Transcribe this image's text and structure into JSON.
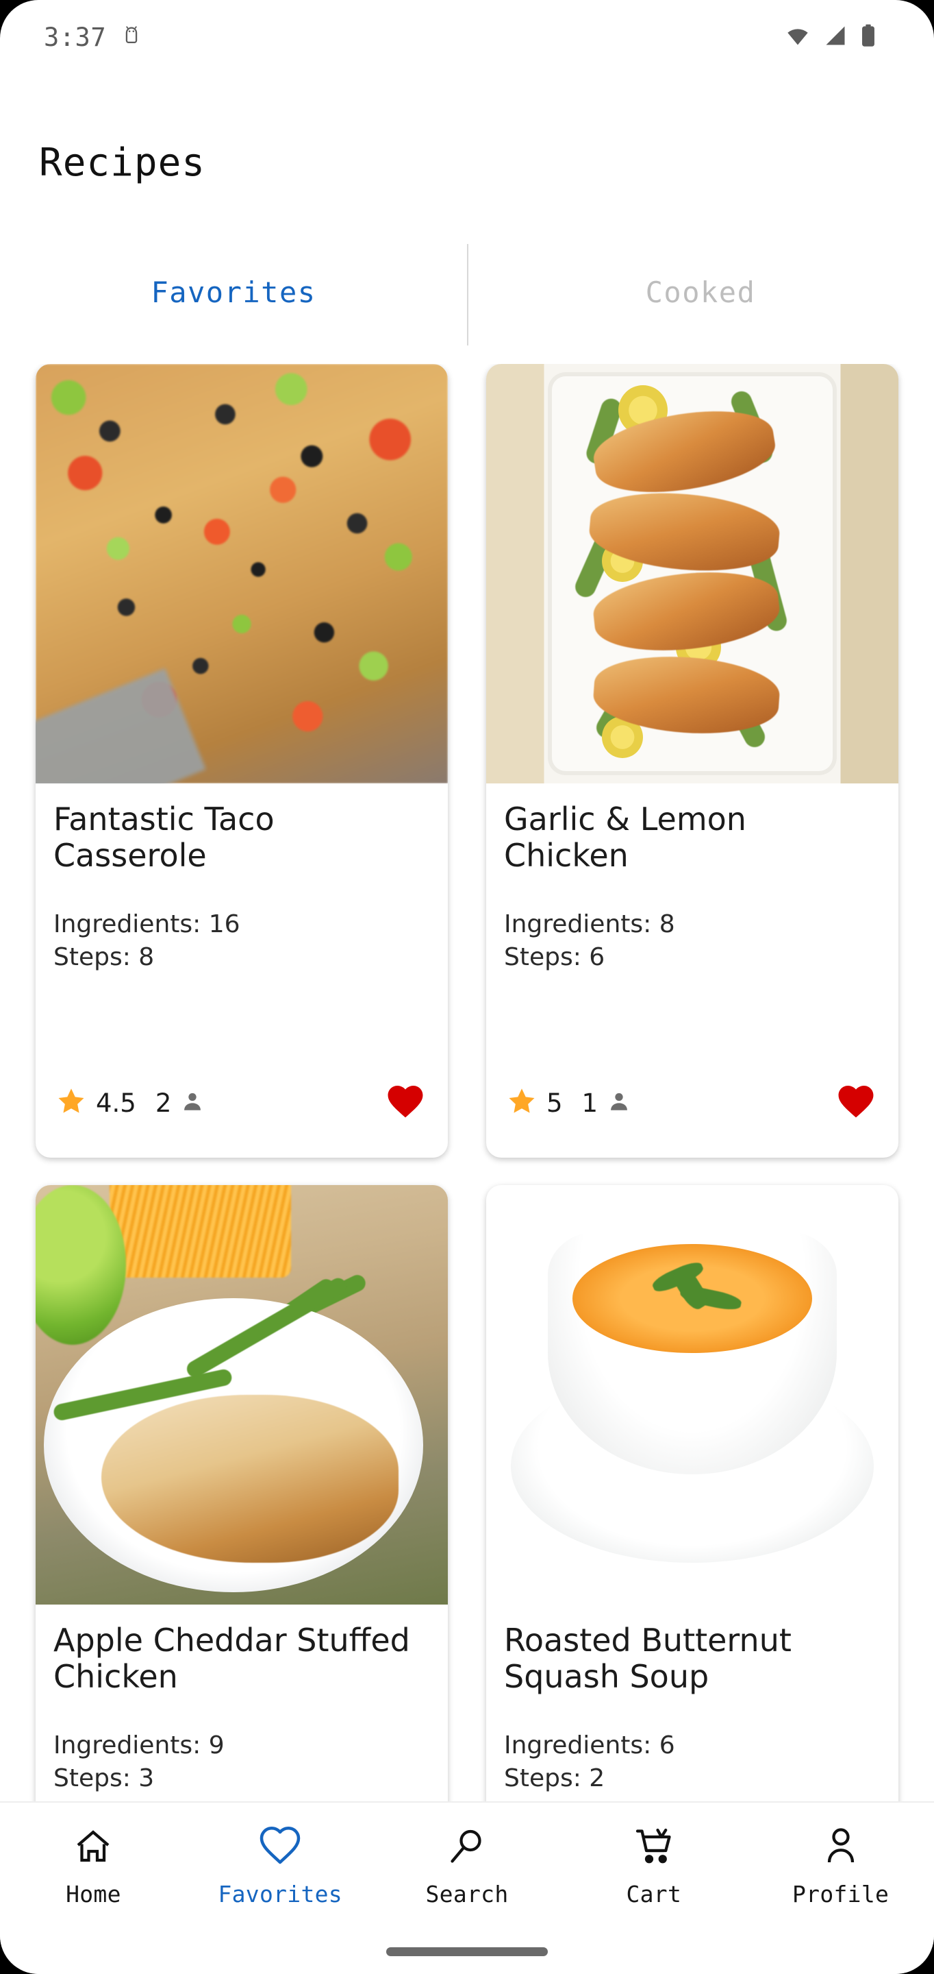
{
  "status_bar": {
    "time": "3:37",
    "icons": [
      "android-icon",
      "wifi-icon",
      "cellular-signal-icon",
      "battery-icon"
    ]
  },
  "header": {
    "title": "Recipes"
  },
  "tabs": [
    {
      "label": "Favorites",
      "active": true
    },
    {
      "label": "Cooked",
      "active": false
    }
  ],
  "colors": {
    "accent_blue": "#1565C0",
    "star_orange": "#FFA726",
    "heart_red": "#D50000",
    "inactive_gray": "#BDBDBD",
    "card_bg": "#FFFFFF",
    "page_bg": "#FFFFFF"
  },
  "recipes": [
    {
      "title": "Fantastic Taco Casserole",
      "ingredients_label": "Ingredients: 16",
      "steps_label": "Steps: 8",
      "ingredients": 16,
      "steps": 8,
      "rating": "4.5",
      "people": "2",
      "favorited": true,
      "image_alt": "taco-casserole-photo"
    },
    {
      "title": "Garlic & Lemon Chicken",
      "ingredients_label": "Ingredients: 8",
      "steps_label": "Steps: 6",
      "ingredients": 8,
      "steps": 6,
      "rating": "5",
      "people": "1",
      "favorited": true,
      "image_alt": "garlic-lemon-chicken-photo"
    },
    {
      "title": "Apple Cheddar Stuffed Chicken",
      "ingredients_label": "Ingredients: 9",
      "steps_label": "Steps: 3",
      "ingredients": 9,
      "steps": 3,
      "rating": "",
      "people": "",
      "favorited": true,
      "image_alt": "apple-cheddar-stuffed-chicken-photo"
    },
    {
      "title": "Roasted Butternut Squash Soup",
      "ingredients_label": "Ingredients: 6",
      "steps_label": "Steps: 2",
      "ingredients": 6,
      "steps": 2,
      "rating": "",
      "people": "",
      "favorited": true,
      "image_alt": "butternut-squash-soup-photo"
    }
  ],
  "bottom_nav": [
    {
      "label": "Home",
      "icon": "home-icon",
      "active": false
    },
    {
      "label": "Favorites",
      "icon": "heart-icon",
      "active": true
    },
    {
      "label": "Search",
      "icon": "search-icon",
      "active": false
    },
    {
      "label": "Cart",
      "icon": "cart-icon",
      "active": false
    },
    {
      "label": "Profile",
      "icon": "person-icon",
      "active": false
    }
  ]
}
